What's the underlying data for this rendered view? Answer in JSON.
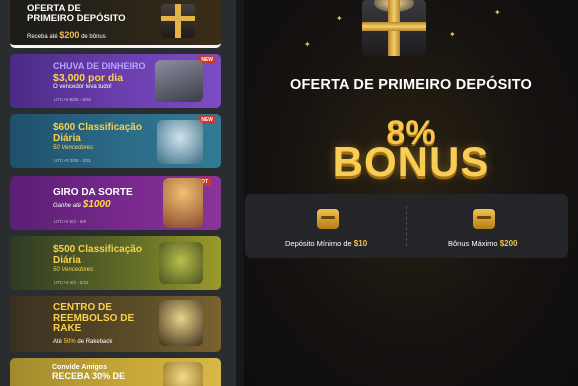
{
  "sidebar": {
    "promos": [
      {
        "title": "OFERTA DE PRIMEIRO DEPÓSITO",
        "line1": "OFERTA DE",
        "line2": "PRIMEIRO DEPÓSITO",
        "sub_pre": "Receba até",
        "sub_amount": "$200",
        "sub_post": "de bônus"
      },
      {
        "title_line1": "CHUVA DE DINHEIRO",
        "title_line2": "$3,000 por dia",
        "sub": "O vencedor leva tudo!",
        "date": "UTC+0 8/29 - 8/31",
        "badge": "NEW"
      },
      {
        "title_line1": "$600 Classificação",
        "title_line2": "Diária",
        "sub": "50 Vencedores",
        "date": "UTC+0 3/30 - 3/31",
        "badge": "NEW"
      },
      {
        "title_line1": "GIRO DA SORTE",
        "sub_pre": "Ganhe até",
        "sub_amount": "$1000",
        "date": "UTC+0 6/3 - 6/5",
        "badge": "HOT"
      },
      {
        "title_line1": "$500 Classificação",
        "title_line2": "Diária",
        "sub": "50 Vencedores",
        "date": "UTC+0 4/3 - 5/31"
      },
      {
        "title_line1": "CENTRO DE",
        "title_line2": "REEMBOLSO DE",
        "title_line3": "RAKE",
        "sub_pre": "Até",
        "sub_amount": "50%",
        "sub_post": "de Rakeback"
      },
      {
        "title_line1": "Convide Amigos",
        "title_line2": "RECEBA 30% DE"
      }
    ]
  },
  "main": {
    "offer_title": "OFERTA DE PRIMEIRO DEPÓSITO",
    "percent": "8%",
    "bonus_word": "BONUS",
    "min_deposit_label": "Depósito Mínimo de",
    "min_deposit_value": "$10",
    "max_bonus_label": "Bônus Máximo",
    "max_bonus_value": "$200",
    "icons": [
      "gift-icon",
      "cash-icon",
      "treasure-chest-icon"
    ]
  },
  "colors": {
    "gold": "#f7c64a",
    "purple_card": "#6c3fb0",
    "teal_card": "#2d6e8a",
    "olive_card": "#8a8f2a",
    "brown_card": "#6b5a2a"
  }
}
